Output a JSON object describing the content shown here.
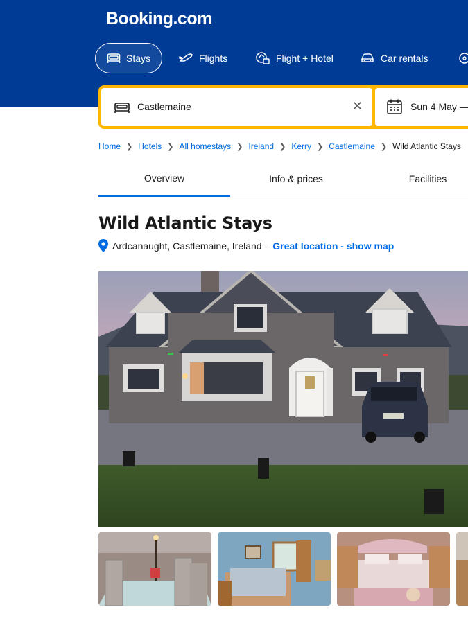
{
  "header": {
    "logo": "Booking.com",
    "nav": [
      {
        "label": "Stays",
        "icon": "bed-icon",
        "active": true
      },
      {
        "label": "Flights",
        "icon": "plane-icon"
      },
      {
        "label": "Flight + Hotel",
        "icon": "flight-hotel-icon"
      },
      {
        "label": "Car rentals",
        "icon": "car-icon"
      }
    ]
  },
  "search": {
    "destination": "Castlemaine",
    "checkin": "Sun 4 May",
    "date_separator": "—"
  },
  "breadcrumb": [
    "Home",
    "Hotels",
    "All homestays",
    "Ireland",
    "Kerry",
    "Castlemaine",
    "Wild Atlantic Stays"
  ],
  "tabs": [
    "Overview",
    "Info & prices",
    "Facilities"
  ],
  "property": {
    "name": "Wild Atlantic Stays",
    "address": "Ardcanaught, Castlemaine, Ireland –",
    "location_link": "Great location - show map"
  },
  "colors": {
    "brand": "#003b95",
    "accent": "#ffb700",
    "link": "#006ce4"
  }
}
